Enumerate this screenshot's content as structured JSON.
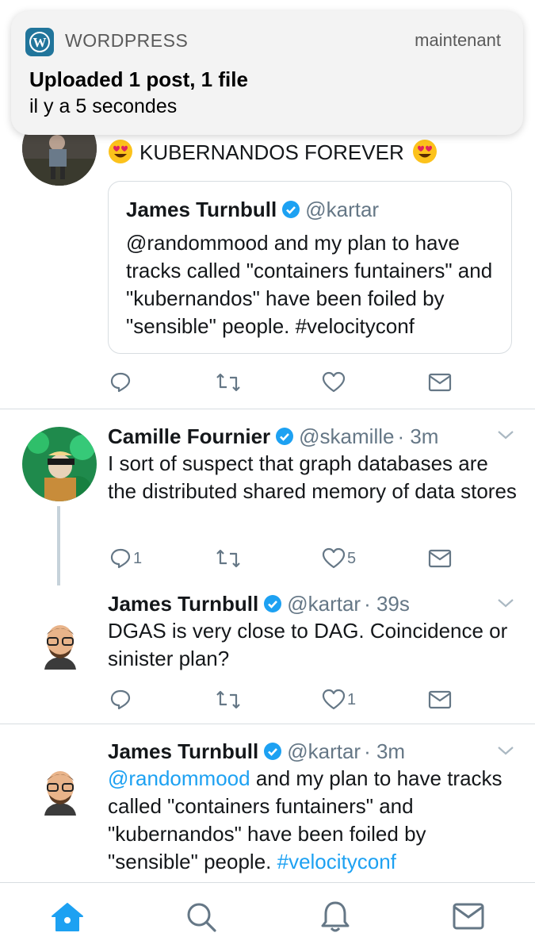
{
  "notification": {
    "app_name": "WORDPRESS",
    "time": "maintenant",
    "title": "Uploaded 1 post, 1 file",
    "body": "il y a 5 secondes"
  },
  "tweet1": {
    "text": "KUBERNANDOS FOREVER",
    "emoji": "heart-eyes",
    "quote": {
      "name": "James Turnbull",
      "handle": "@kartar",
      "text": "@randommood and my plan to have tracks called \"containers funtainers\" and \"kubernandos\" have been foiled by \"sensible\" people. #velocityconf"
    },
    "actions": {
      "reply": "",
      "retweet": "",
      "like": ""
    }
  },
  "tweet2": {
    "name": "Camille Fournier",
    "handle": "@skamille",
    "time": "· 3m",
    "text": "I sort of suspect that graph databases are the distributed shared memory of data stores",
    "actions": {
      "reply": "1",
      "retweet": "",
      "like": "5"
    }
  },
  "tweet3": {
    "name": "James Turnbull",
    "handle": "@kartar",
    "time": "· 39s",
    "text": "DGAS is very close to DAG. Coincidence or sinister plan?",
    "actions": {
      "reply": "",
      "retweet": "",
      "like": "1"
    }
  },
  "tweet4": {
    "name": "James Turnbull",
    "handle": "@kartar",
    "time": "· 3m",
    "mention": "@randommood",
    "text": " and my plan to have tracks called \"containers funtainers\" and \"kubernandos\" have been foiled by \"sensible\" people. ",
    "hashtag": "#velocityconf"
  },
  "colors": {
    "accent": "#1da1f2",
    "muted": "#657786",
    "text": "#14171a",
    "divider": "#d8dde1"
  },
  "tabbar": {
    "items": [
      "home-icon",
      "search-icon",
      "notifications-icon",
      "messages-icon"
    ],
    "active": "home-icon"
  }
}
